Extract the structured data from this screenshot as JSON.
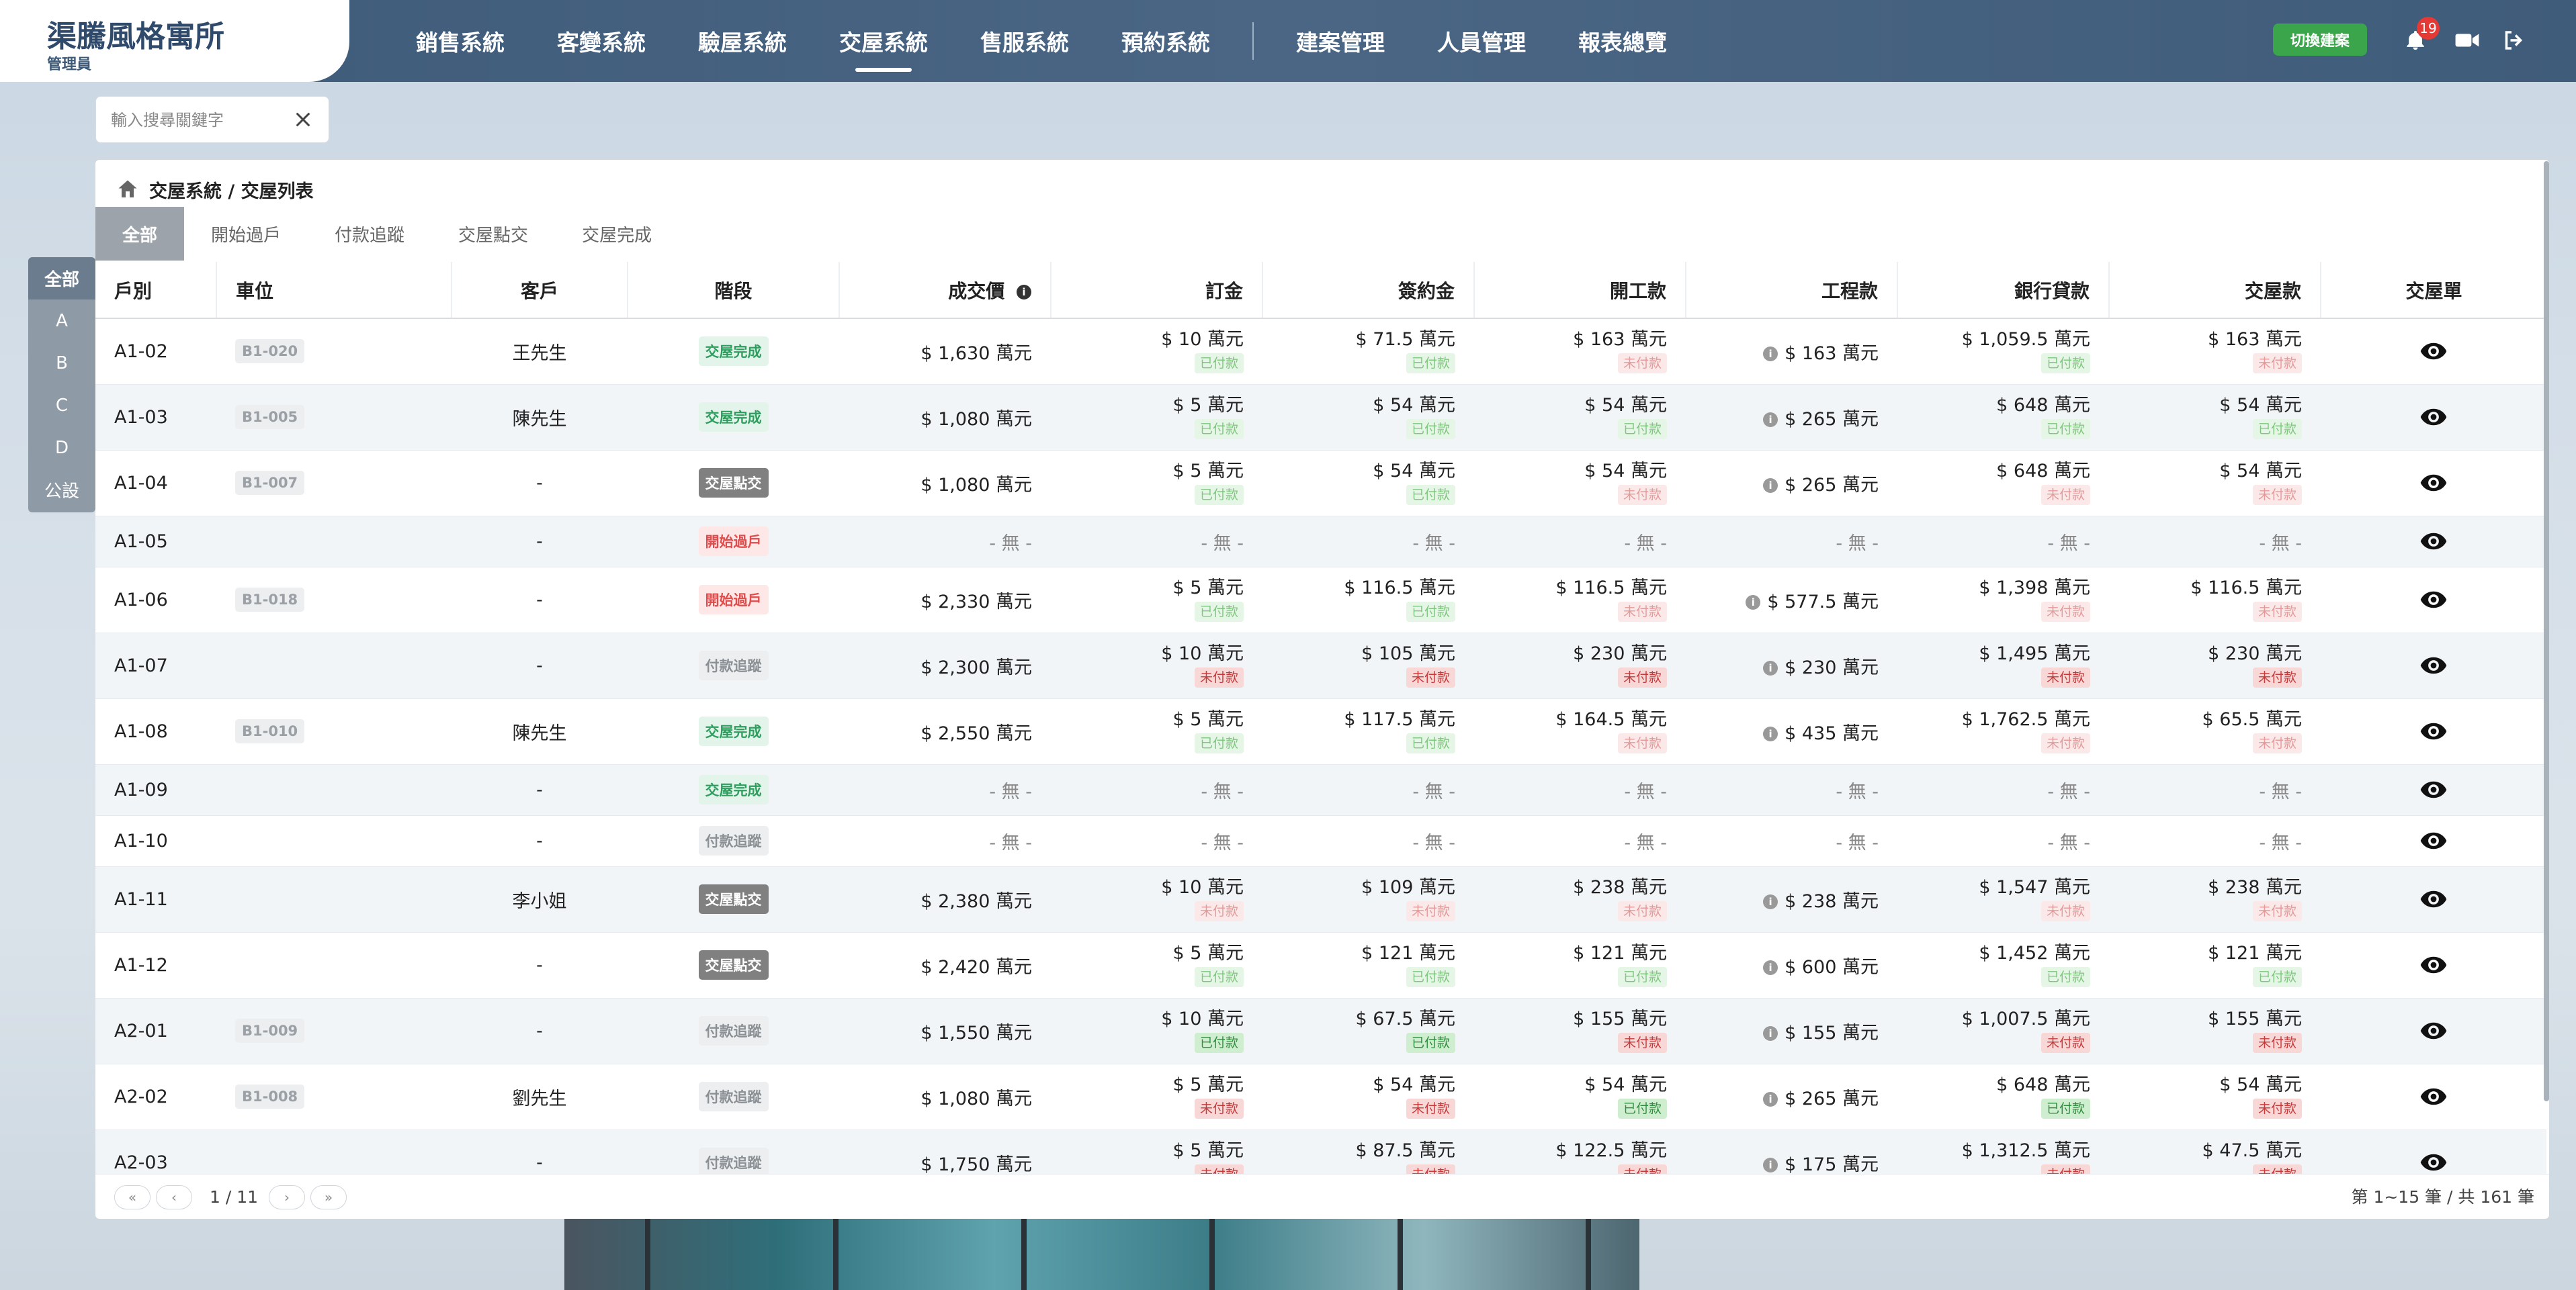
{
  "brand": {
    "title": "渠騰風格寓所",
    "role": "管理員"
  },
  "nav": {
    "items": [
      "銷售系統",
      "客變系統",
      "驗屋系統",
      "交屋系統",
      "售服系統",
      "預約系統"
    ],
    "items2": [
      "建案管理",
      "人員管理",
      "報表總覽"
    ],
    "active": "交屋系統"
  },
  "header": {
    "switch_label": "切換建案",
    "notification_count": "19"
  },
  "search": {
    "placeholder": "輸入搜尋關鍵字"
  },
  "side_index": [
    "全部",
    "A",
    "B",
    "C",
    "D",
    "公設"
  ],
  "breadcrumb": "交屋系統 / 交屋列表",
  "tabs": [
    "全部",
    "開始過戶",
    "付款追蹤",
    "交屋點交",
    "交屋完成"
  ],
  "columns": [
    "戶別",
    "車位",
    "客戶",
    "階段",
    "成交價",
    "訂金",
    "簽約金",
    "開工款",
    "工程款",
    "銀行貸款",
    "交屋款",
    "交屋單"
  ],
  "rows": [
    {
      "unit": "A1-02",
      "parking": "B1-020",
      "customer": "王先生",
      "stage": "交屋完成",
      "stage_color": "green",
      "price": "$ 1,630 萬元",
      "deposit": {
        "amt": "$ 10 萬元",
        "status": "已付款",
        "tone": "paid-l"
      },
      "contract": {
        "amt": "$ 71.5 萬元",
        "status": "已付款",
        "tone": "paid-l"
      },
      "start": {
        "amt": "$ 163 萬元",
        "status": "未付款",
        "tone": "unpaid-l"
      },
      "eng": "$ 163 萬元",
      "loan": {
        "amt": "$ 1,059.5 萬元",
        "status": "已付款",
        "tone": "paid-l"
      },
      "handover": {
        "amt": "$ 163 萬元",
        "status": "未付款",
        "tone": "unpaid-l"
      }
    },
    {
      "unit": "A1-03",
      "parking": "B1-005",
      "customer": "陳先生",
      "stage": "交屋完成",
      "stage_color": "green",
      "price": "$ 1,080 萬元",
      "deposit": {
        "amt": "$ 5 萬元",
        "status": "已付款",
        "tone": "paid-l"
      },
      "contract": {
        "amt": "$ 54 萬元",
        "status": "已付款",
        "tone": "paid-l"
      },
      "start": {
        "amt": "$ 54 萬元",
        "status": "已付款",
        "tone": "paid-l"
      },
      "eng": "$ 265 萬元",
      "loan": {
        "amt": "$ 648 萬元",
        "status": "已付款",
        "tone": "paid-l"
      },
      "handover": {
        "amt": "$ 54 萬元",
        "status": "已付款",
        "tone": "paid-l"
      }
    },
    {
      "unit": "A1-04",
      "parking": "B1-007",
      "customer": "-",
      "stage": "交屋點交",
      "stage_color": "dark",
      "price": "$ 1,080 萬元",
      "deposit": {
        "amt": "$ 5 萬元",
        "status": "已付款",
        "tone": "paid-l"
      },
      "contract": {
        "amt": "$ 54 萬元",
        "status": "已付款",
        "tone": "paid-l"
      },
      "start": {
        "amt": "$ 54 萬元",
        "status": "未付款",
        "tone": "unpaid-l"
      },
      "eng": "$ 265 萬元",
      "loan": {
        "amt": "$ 648 萬元",
        "status": "未付款",
        "tone": "unpaid-l"
      },
      "handover": {
        "amt": "$ 54 萬元",
        "status": "未付款",
        "tone": "unpaid-l"
      }
    },
    {
      "unit": "A1-05",
      "parking": "",
      "customer": "-",
      "stage": "開始過戶",
      "stage_color": "red",
      "price": "- 無 -",
      "none": true
    },
    {
      "unit": "A1-06",
      "parking": "B1-018",
      "customer": "-",
      "stage": "開始過戶",
      "stage_color": "red",
      "price": "$ 2,330 萬元",
      "deposit": {
        "amt": "$ 5 萬元",
        "status": "已付款",
        "tone": "paid-l"
      },
      "contract": {
        "amt": "$ 116.5 萬元",
        "status": "已付款",
        "tone": "paid-l"
      },
      "start": {
        "amt": "$ 116.5 萬元",
        "status": "未付款",
        "tone": "unpaid-l"
      },
      "eng": "$ 577.5 萬元",
      "loan": {
        "amt": "$ 1,398 萬元",
        "status": "未付款",
        "tone": "unpaid-l"
      },
      "handover": {
        "amt": "$ 116.5 萬元",
        "status": "未付款",
        "tone": "unpaid-l"
      }
    },
    {
      "unit": "A1-07",
      "parking": "",
      "customer": "-",
      "stage": "付款追蹤",
      "stage_color": "gray",
      "price": "$ 2,300 萬元",
      "deposit": {
        "amt": "$ 10 萬元",
        "status": "未付款",
        "tone": "unpaid"
      },
      "contract": {
        "amt": "$ 105 萬元",
        "status": "未付款",
        "tone": "unpaid"
      },
      "start": {
        "amt": "$ 230 萬元",
        "status": "未付款",
        "tone": "unpaid"
      },
      "eng": "$ 230 萬元",
      "loan": {
        "amt": "$ 1,495 萬元",
        "status": "未付款",
        "tone": "unpaid"
      },
      "handover": {
        "amt": "$ 230 萬元",
        "status": "未付款",
        "tone": "unpaid"
      }
    },
    {
      "unit": "A1-08",
      "parking": "B1-010",
      "customer": "陳先生",
      "stage": "交屋完成",
      "stage_color": "green",
      "price": "$ 2,550 萬元",
      "deposit": {
        "amt": "$ 5 萬元",
        "status": "已付款",
        "tone": "paid-l"
      },
      "contract": {
        "amt": "$ 117.5 萬元",
        "status": "已付款",
        "tone": "paid-l"
      },
      "start": {
        "amt": "$ 164.5 萬元",
        "status": "未付款",
        "tone": "unpaid-l"
      },
      "eng": "$ 435 萬元",
      "loan": {
        "amt": "$ 1,762.5 萬元",
        "status": "未付款",
        "tone": "unpaid-l"
      },
      "handover": {
        "amt": "$ 65.5 萬元",
        "status": "未付款",
        "tone": "unpaid-l"
      }
    },
    {
      "unit": "A1-09",
      "parking": "",
      "customer": "-",
      "stage": "交屋完成",
      "stage_color": "green",
      "price": "- 無 -",
      "none": true
    },
    {
      "unit": "A1-10",
      "parking": "",
      "customer": "-",
      "stage": "付款追蹤",
      "stage_color": "gray",
      "price": "- 無 -",
      "none": true
    },
    {
      "unit": "A1-11",
      "parking": "",
      "customer": "李小姐",
      "stage": "交屋點交",
      "stage_color": "dark",
      "price": "$ 2,380 萬元",
      "deposit": {
        "amt": "$ 10 萬元",
        "status": "未付款",
        "tone": "unpaid-l"
      },
      "contract": {
        "amt": "$ 109 萬元",
        "status": "未付款",
        "tone": "unpaid-l"
      },
      "start": {
        "amt": "$ 238 萬元",
        "status": "未付款",
        "tone": "unpaid-l"
      },
      "eng": "$ 238 萬元",
      "loan": {
        "amt": "$ 1,547 萬元",
        "status": "未付款",
        "tone": "unpaid-l"
      },
      "handover": {
        "amt": "$ 238 萬元",
        "status": "未付款",
        "tone": "unpaid-l"
      }
    },
    {
      "unit": "A1-12",
      "parking": "",
      "customer": "-",
      "stage": "交屋點交",
      "stage_color": "dark",
      "price": "$ 2,420 萬元",
      "deposit": {
        "amt": "$ 5 萬元",
        "status": "已付款",
        "tone": "paid-l"
      },
      "contract": {
        "amt": "$ 121 萬元",
        "status": "已付款",
        "tone": "paid-l"
      },
      "start": {
        "amt": "$ 121 萬元",
        "status": "已付款",
        "tone": "paid-l"
      },
      "eng": "$ 600 萬元",
      "loan": {
        "amt": "$ 1,452 萬元",
        "status": "已付款",
        "tone": "paid-l"
      },
      "handover": {
        "amt": "$ 121 萬元",
        "status": "已付款",
        "tone": "paid-l"
      }
    },
    {
      "unit": "A2-01",
      "parking": "B1-009",
      "customer": "-",
      "stage": "付款追蹤",
      "stage_color": "gray",
      "price": "$ 1,550 萬元",
      "deposit": {
        "amt": "$ 10 萬元",
        "status": "已付款",
        "tone": "paid"
      },
      "contract": {
        "amt": "$ 67.5 萬元",
        "status": "已付款",
        "tone": "paid"
      },
      "start": {
        "amt": "$ 155 萬元",
        "status": "未付款",
        "tone": "unpaid"
      },
      "eng": "$ 155 萬元",
      "loan": {
        "amt": "$ 1,007.5 萬元",
        "status": "未付款",
        "tone": "unpaid"
      },
      "handover": {
        "amt": "$ 155 萬元",
        "status": "未付款",
        "tone": "unpaid"
      }
    },
    {
      "unit": "A2-02",
      "parking": "B1-008",
      "customer": "劉先生",
      "stage": "付款追蹤",
      "stage_color": "gray",
      "price": "$ 1,080 萬元",
      "deposit": {
        "amt": "$ 5 萬元",
        "status": "未付款",
        "tone": "unpaid"
      },
      "contract": {
        "amt": "$ 54 萬元",
        "status": "未付款",
        "tone": "unpaid"
      },
      "start": {
        "amt": "$ 54 萬元",
        "status": "已付款",
        "tone": "paid"
      },
      "eng": "$ 265 萬元",
      "loan": {
        "amt": "$ 648 萬元",
        "status": "已付款",
        "tone": "paid"
      },
      "handover": {
        "amt": "$ 54 萬元",
        "status": "未付款",
        "tone": "unpaid"
      }
    },
    {
      "unit": "A2-03",
      "parking": "",
      "customer": "-",
      "stage": "付款追蹤",
      "stage_color": "gray",
      "price": "$ 1,750 萬元",
      "deposit": {
        "amt": "$ 5 萬元",
        "status": "未付款",
        "tone": "unpaid"
      },
      "contract": {
        "amt": "$ 87.5 萬元",
        "status": "未付款",
        "tone": "unpaid"
      },
      "start": {
        "amt": "$ 122.5 萬元",
        "status": "未付款",
        "tone": "unpaid"
      },
      "eng": "$ 175 萬元",
      "loan": {
        "amt": "$ 1,312.5 萬元",
        "status": "未付款",
        "tone": "unpaid"
      },
      "handover": {
        "amt": "$ 47.5 萬元",
        "status": "未付款",
        "tone": "unpaid"
      }
    }
  ],
  "none_text": "- 無 -",
  "pagination": {
    "page": "1 / 11",
    "summary": "第 1~15 筆 / 共 161 筆"
  },
  "colors": {
    "header": "#3d5a78",
    "switch": "#3aa54a",
    "badge": "#e53935"
  }
}
